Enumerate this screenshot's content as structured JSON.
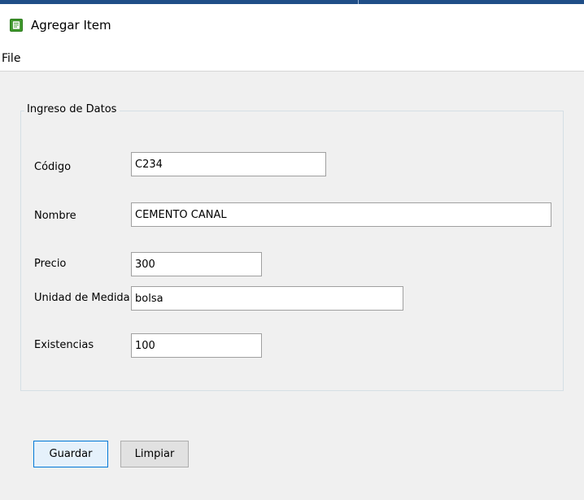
{
  "window": {
    "title": "Agregar Item",
    "icon": "app-form-icon",
    "accent_color": "#1f4e87"
  },
  "menubar": {
    "items": [
      {
        "label": "File"
      }
    ]
  },
  "form": {
    "group_title": "Ingreso de Datos",
    "fields": {
      "codigo": {
        "label": "Código",
        "value": "C234"
      },
      "nombre": {
        "label": "Nombre",
        "value": "CEMENTO CANAL"
      },
      "precio": {
        "label": "Precio",
        "value": "300"
      },
      "unidad": {
        "label": "Unidad de Medida",
        "value": "bolsa"
      },
      "existencias": {
        "label": "Existencias",
        "value": "100"
      }
    }
  },
  "buttons": {
    "save": "Guardar",
    "clear": "Limpiar"
  }
}
